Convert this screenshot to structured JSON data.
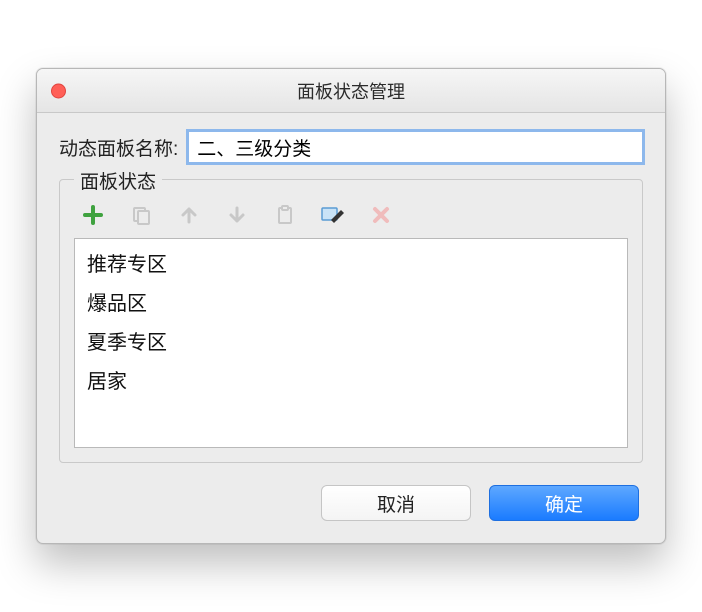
{
  "dialog": {
    "title": "面板状态管理",
    "name_label": "动态面板名称:",
    "name_value": "二、三级分类",
    "fieldset_legend": "面板状态"
  },
  "toolbar": {
    "add": "add-icon",
    "duplicate": "duplicate-icon",
    "up": "arrow-up-icon",
    "down": "arrow-down-icon",
    "paste": "paste-icon",
    "edit": "edit-icon",
    "delete": "delete-icon"
  },
  "states": [
    "推荐专区",
    "爆品区",
    "夏季专区",
    "居家"
  ],
  "footer": {
    "cancel": "取消",
    "ok": "确定"
  },
  "colors": {
    "primary": "#1a7bff",
    "add": "#3fa23f",
    "disabled": "#c8c8c8"
  }
}
